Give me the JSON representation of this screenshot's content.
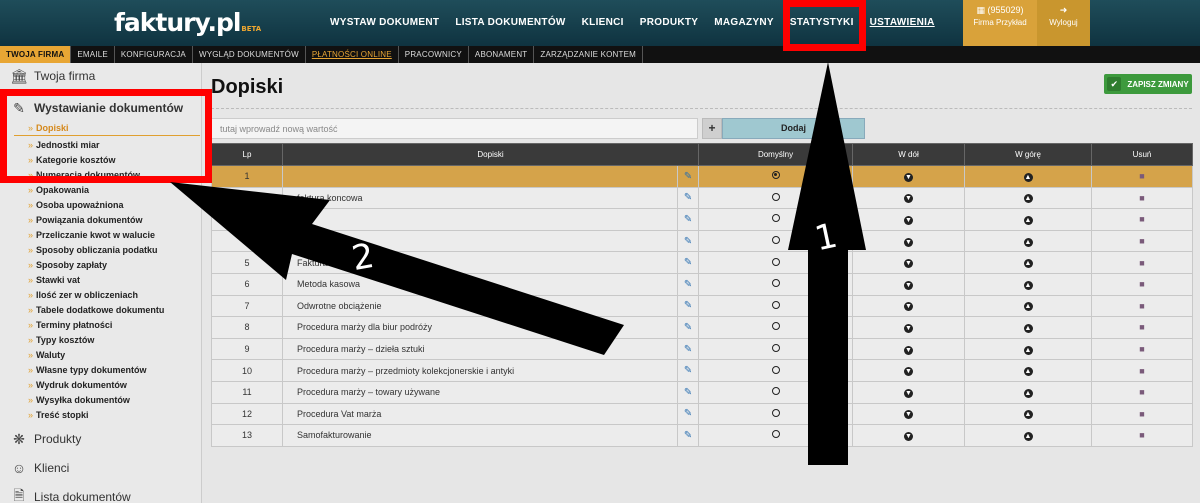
{
  "header": {
    "logo": "faktury.pl",
    "logo_badge": "BETA",
    "nav": [
      "WYSTAW DOKUMENT",
      "LISTA DOKUMENTÓW",
      "KLIENCI",
      "PRODUKTY",
      "MAGAZYNY",
      "STATYSTYKI",
      "USTAWIENIA"
    ],
    "firm_id": "(955029)",
    "firm_name": "Firma Przykład",
    "logout": "Wyloguj"
  },
  "subnav": [
    "TWOJA FIRMA",
    "EMAILE",
    "KONFIGURACJA",
    "WYGLĄD DOKUMENTÓW",
    "PŁATNOŚCI ONLINE",
    "PRACOWNICY",
    "ABONAMENT",
    "ZARZĄDZANIE KONTEM"
  ],
  "sidebar": {
    "twoja_firma": "Twoja firma",
    "wystawianie": "Wystawianie dokumentów",
    "items": [
      "Dopiski",
      "Jednostki miar",
      "Kategorie kosztów",
      "Numeracja dokumentów",
      "Opakowania",
      "Osoba upoważniona",
      "Powiązania dokumentów",
      "Przeliczanie kwot w walucie",
      "Sposoby obliczania podatku",
      "Sposoby zapłaty",
      "Stawki vat",
      "Ilość zer w obliczeniach",
      "Tabele dodatkowe dokumentu",
      "Terminy płatności",
      "Typy kosztów",
      "Waluty",
      "Własne typy dokumentów",
      "Wydruk dokumentów",
      "Wysyłka dokumentów",
      "Treść stopki"
    ],
    "produkty": "Produkty",
    "klienci": "Klienci",
    "lista": "Lista dokumentów"
  },
  "main": {
    "title": "Dopiski",
    "save_label": "ZAPISZ ZMIANY",
    "input_placeholder": "tutaj wprowadź nową wartość",
    "add_label": "Dodaj",
    "columns": [
      "Lp",
      "Dopiski",
      "Domyślny",
      "W dół",
      "W górę",
      "Usuń"
    ],
    "rows": [
      {
        "lp": "1",
        "text": ""
      },
      {
        "lp": "2",
        "text": "faktura koncowa"
      },
      {
        "lp": "3",
        "text": ""
      },
      {
        "lp": "4",
        "text": ""
      },
      {
        "lp": "5",
        "text": "Faktura"
      },
      {
        "lp": "6",
        "text": "Metoda kasowa"
      },
      {
        "lp": "7",
        "text": "Odwrotne obciążenie"
      },
      {
        "lp": "8",
        "text": "Procedura marży dla biur podróży"
      },
      {
        "lp": "9",
        "text": "Procedura marży – dzieła sztuki"
      },
      {
        "lp": "10",
        "text": "Procedura marży – przedmioty kolekcjonerskie i antyki"
      },
      {
        "lp": "11",
        "text": "Procedura marży – towary używane"
      },
      {
        "lp": "12",
        "text": "Procedura Vat marża"
      },
      {
        "lp": "13",
        "text": "Samofakturowanie"
      }
    ]
  },
  "annotations": {
    "label_1": "1",
    "label_2": "2",
    "arrow_color": "#000000",
    "box_color": "#ff0000"
  }
}
